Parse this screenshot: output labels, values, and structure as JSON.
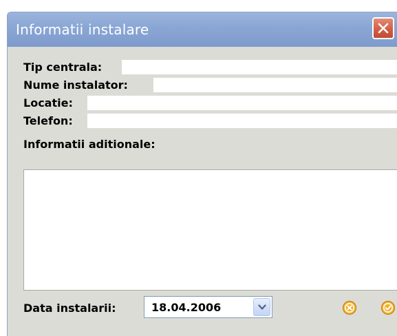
{
  "window": {
    "title": "Informatii instalare"
  },
  "form": {
    "tip_centrala_label": "Tip centrala:",
    "tip_centrala_value": "",
    "nume_instalator_label": "Nume instalator:",
    "nume_instalator_value": "",
    "locatie_label": "Locatie:",
    "locatie_value": "",
    "telefon_label": "Telefon:",
    "telefon_value": "",
    "informatii_label": "Informatii aditionale:",
    "informatii_value": ""
  },
  "footer": {
    "data_label": "Data instalarii:",
    "data_value": "18.04.2006"
  },
  "icons": {
    "close": "close-icon",
    "dropdown": "chevron-down-icon",
    "cancel": "cancel-icon",
    "confirm": "check-icon"
  },
  "colors": {
    "titlebar": "#89a6d4",
    "close_button": "#d05c43",
    "window_background": "#dcdcd6",
    "action_icon": "#f0a020"
  }
}
